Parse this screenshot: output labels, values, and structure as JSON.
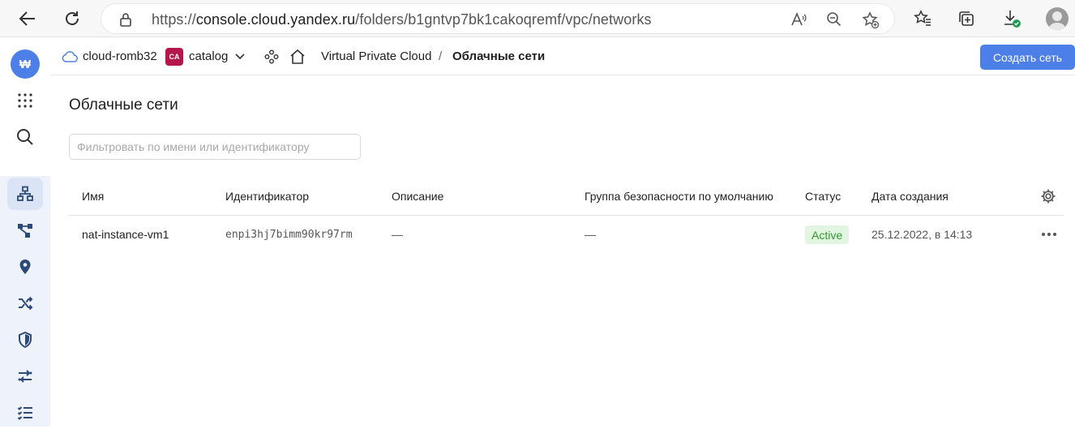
{
  "browser": {
    "url_prefix": "https://",
    "url_host": "console.cloud.yandex.ru",
    "url_path": "/folders/b1gntvp7bk1cakoqremf/vpc/networks"
  },
  "header": {
    "cloud_name": "cloud-romb32",
    "folder_badge": "CA",
    "folder_name": "catalog",
    "service_name": "Virtual Private Cloud",
    "separator": "/",
    "current_page": "Облачные сети",
    "create_button": "Создать сеть"
  },
  "main": {
    "title": "Облачные сети",
    "filter_placeholder": "Фильтровать по имени или идентификатору",
    "columns": {
      "name": "Имя",
      "id": "Идентификатор",
      "description": "Описание",
      "security_group": "Группа безопасности по умолчанию",
      "status": "Статус",
      "created": "Дата создания"
    },
    "rows": [
      {
        "name": "nat-instance-vm1",
        "id": "enpi3hj7bimm90kr97rm",
        "description": "—",
        "security_group": "—",
        "status": "Active",
        "created": "25.12.2022, в 14:13"
      }
    ]
  },
  "colors": {
    "accent": "#4d7fe9",
    "status_active_bg": "#e1f5e1",
    "status_active_text": "#2e9a2e",
    "folder_badge": "#b5164c"
  },
  "icons": {
    "rail": [
      "cloud-logo-icon",
      "apps-grid-icon",
      "search-icon",
      "network-icon",
      "topology-icon",
      "location-pin-icon",
      "routing-icon",
      "security-shield-icon",
      "transfer-icon",
      "list-icon"
    ]
  }
}
